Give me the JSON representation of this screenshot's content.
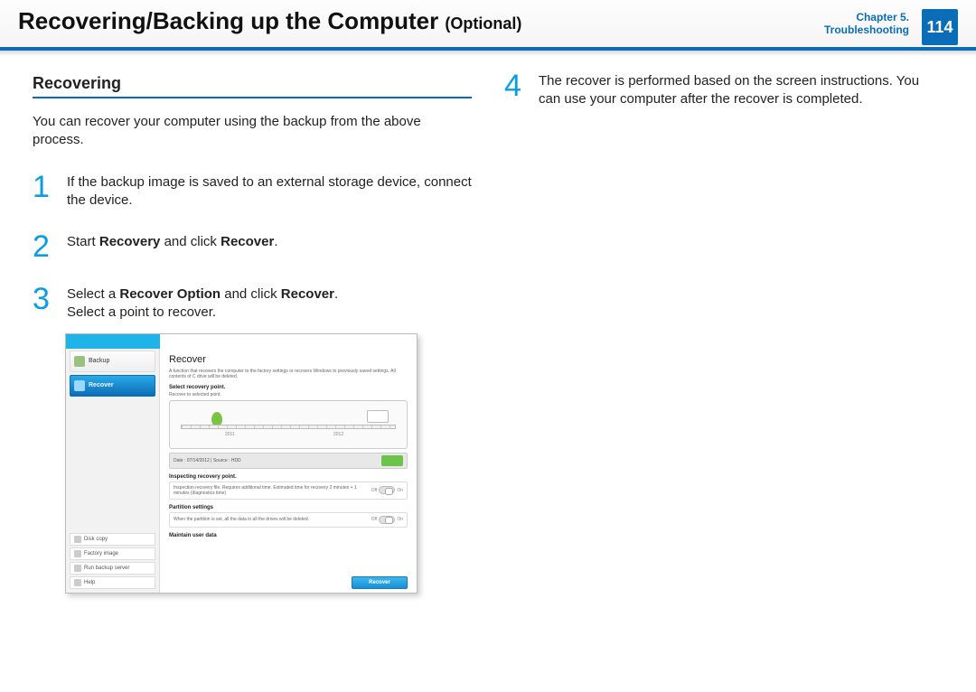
{
  "header": {
    "title_main": "Recovering/Backing up the Computer",
    "title_suffix": "(Optional)",
    "chapter_line1": "Chapter 5.",
    "chapter_line2": "Troubleshooting",
    "page_number": "114"
  },
  "left": {
    "section": "Recovering",
    "intro": "You can recover your computer using the backup from the above process.",
    "steps": [
      {
        "num": "1",
        "text_plain": "If the backup image is saved to an external storage device, connect the device."
      },
      {
        "num": "2",
        "text_pre": "Start ",
        "b1": "Recovery",
        "mid": " and click ",
        "b2": "Recover",
        "post": "."
      },
      {
        "num": "3",
        "text_pre": "Select a ",
        "b1": "Recover Option",
        "mid": " and click ",
        "b2": "Recover",
        "post": ".",
        "line2": "Select a point to recover."
      }
    ]
  },
  "right": {
    "steps": [
      {
        "num": "4",
        "text": "The recover is performed based on the screen instructions. You can use your computer after the recover is completed."
      }
    ]
  },
  "screenshot": {
    "sidebar_top": [
      {
        "label": "Backup",
        "active": false
      },
      {
        "label": "Recover",
        "active": true
      }
    ],
    "sidebar_bottom": [
      "Disk copy",
      "Factory image",
      "Run backup server",
      "Help"
    ],
    "main_title": "Recover",
    "main_desc": "A function that recovers the computer to the factory settings or recovers Windows to previously saved settings. All contents of C drive will be deleted.",
    "select_label": "Select recovery point.",
    "select_sub": "Recover to selected point.",
    "year_left": "2011",
    "year_right": "2012",
    "info_row": "Date :  07/14/2012   |   Source :  HDD",
    "inspect_label": "Inspecting recovery point.",
    "inspect_text": "Inspection recovery file. Requires additional time. Estimated time for recovery 2 minutes + 1 minutes (diagnostics time)",
    "partition_label": "Partition settings",
    "partition_text": "When the partition is set, all the data in all the drives will be deleted.",
    "maintain_label": "Maintain user data",
    "toggle_off": "Off",
    "toggle_on": "On",
    "recover_button": "Recover"
  }
}
